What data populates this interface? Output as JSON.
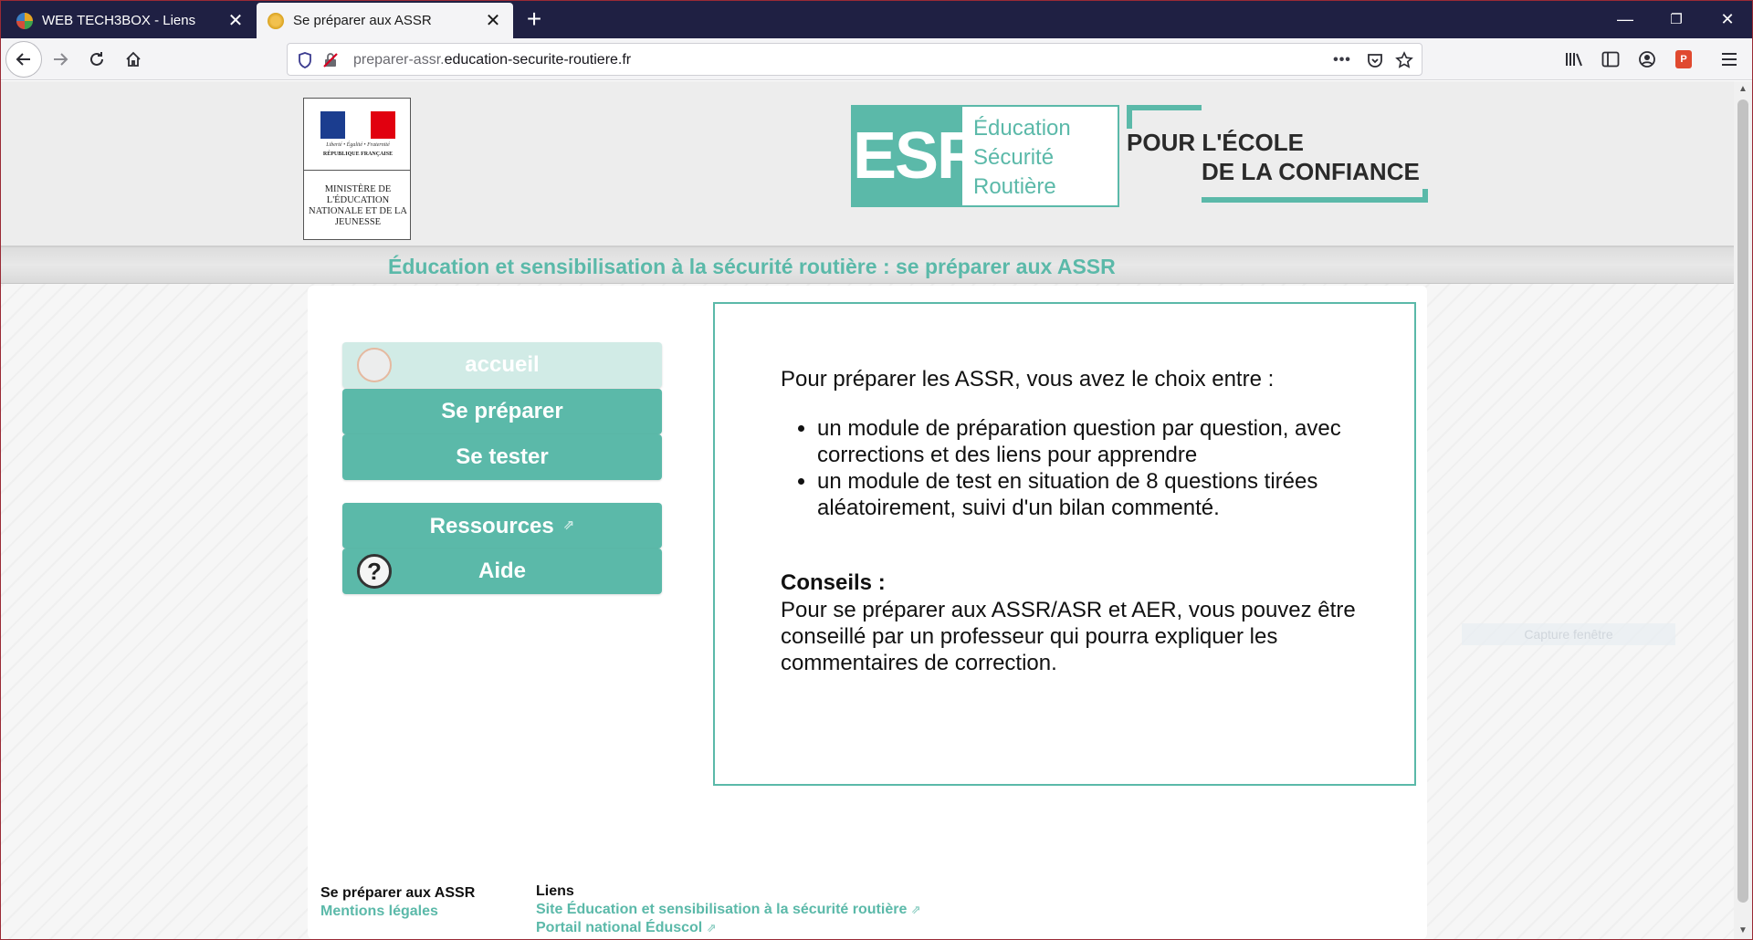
{
  "browser": {
    "tabs": [
      {
        "title": "WEB TECH3BOX - Liens",
        "close": "✕"
      },
      {
        "title": "Se préparer aux ASSR",
        "close": "✕"
      }
    ],
    "new_tab": "+",
    "window_controls": {
      "minimize": "—",
      "restore": "❐",
      "close": "✕"
    },
    "url_prefix": "preparer-assr.",
    "url_domain": "education-securite-routiere.fr",
    "url_more": "•••"
  },
  "header": {
    "marianne": {
      "motto": "Liberté • Égalité • Fraternité",
      "republic": "RÉPUBLIQUE FRANÇAISE",
      "ministry": "MINISTÈRE DE L'ÉDUCATION NATIONALE ET DE LA JEUNESSE"
    },
    "esr_mark": "ESR",
    "esr_words": [
      "Éducation",
      "Sécurité",
      "Routière"
    ],
    "slogan_line1": "POUR L'ÉCOLE",
    "slogan_line2": "DE LA CONFIANCE",
    "subtitle": "Éducation et sensibilisation à la sécurité routière : se préparer aux ASSR"
  },
  "menu": {
    "home": "accueil",
    "prepare": "Se préparer",
    "test": "Se tester",
    "resources": "Ressources",
    "help": "Aide",
    "help_icon": "?",
    "external_mark": "⇗"
  },
  "info": {
    "intro": "Pour préparer les ASSR, vous avez le choix entre :",
    "items": [
      "un module de préparation question par question, avec corrections et des liens pour apprendre",
      "un module de test en situation de 8 questions tirées aléatoirement, suivi d'un bilan commenté."
    ],
    "advice_title": "Conseils :",
    "advice_text": "Pour se préparer aux ASSR/ASR et AER, vous pouvez être conseillé par un professeur qui pourra expliquer les commentaires de correction."
  },
  "footer": {
    "col1_title": "Se préparer aux ASSR",
    "legal": "Mentions légales",
    "col2_title": "Liens",
    "link1": "Site Éducation et sensibilisation à la sécurité routière",
    "link2": "Portail national Éduscol",
    "external_mark": "⇗"
  },
  "overlay": {
    "ghost_label": "Capture fenêtre"
  },
  "colors": {
    "accent": "#5bb9a9",
    "tabbar": "#1f2043",
    "flag_blue": "#1b3d8f",
    "flag_red": "#e1000f"
  }
}
